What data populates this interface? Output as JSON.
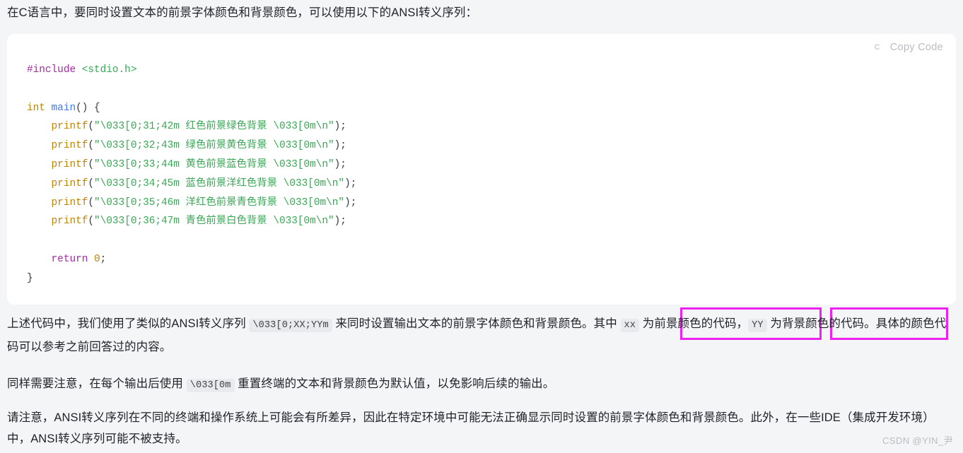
{
  "intro_paragraph": "在C语言中，要同时设置文本的前景字体颜色和背景颜色，可以使用以下的ANSI转义序列：",
  "code_block": {
    "language_label": "c",
    "copy_label": "Copy Code",
    "lines": [
      {
        "id": "l1",
        "tokens": [
          {
            "t": "#include ",
            "c": "t-pre"
          },
          {
            "t": "<stdio.h>",
            "c": "t-str-h"
          }
        ]
      },
      {
        "id": "l2",
        "tokens": []
      },
      {
        "id": "l3",
        "tokens": [
          {
            "t": "int ",
            "c": "t-kw"
          },
          {
            "t": "main",
            "c": "t-fn"
          },
          {
            "t": "() {",
            "c": "t-punct"
          }
        ]
      },
      {
        "id": "l4",
        "tokens": [
          {
            "t": "    ",
            "c": "t-punct"
          },
          {
            "t": "printf",
            "c": "t-call"
          },
          {
            "t": "(",
            "c": "t-punct"
          },
          {
            "t": "\"\\033[0;31;42m 红色前景绿色背景 \\033[0m\\n\"",
            "c": "t-str"
          },
          {
            "t": ");",
            "c": "t-punct"
          }
        ]
      },
      {
        "id": "l5",
        "tokens": [
          {
            "t": "    ",
            "c": "t-punct"
          },
          {
            "t": "printf",
            "c": "t-call"
          },
          {
            "t": "(",
            "c": "t-punct"
          },
          {
            "t": "\"\\033[0;32;43m 绿色前景黄色背景 \\033[0m\\n\"",
            "c": "t-str"
          },
          {
            "t": ");",
            "c": "t-punct"
          }
        ]
      },
      {
        "id": "l6",
        "tokens": [
          {
            "t": "    ",
            "c": "t-punct"
          },
          {
            "t": "printf",
            "c": "t-call"
          },
          {
            "t": "(",
            "c": "t-punct"
          },
          {
            "t": "\"\\033[0;33;44m 黄色前景蓝色背景 \\033[0m\\n\"",
            "c": "t-str"
          },
          {
            "t": ");",
            "c": "t-punct"
          }
        ]
      },
      {
        "id": "l7",
        "tokens": [
          {
            "t": "    ",
            "c": "t-punct"
          },
          {
            "t": "printf",
            "c": "t-call"
          },
          {
            "t": "(",
            "c": "t-punct"
          },
          {
            "t": "\"\\033[0;34;45m 蓝色前景洋红色背景 \\033[0m\\n\"",
            "c": "t-str"
          },
          {
            "t": ");",
            "c": "t-punct"
          }
        ]
      },
      {
        "id": "l8",
        "tokens": [
          {
            "t": "    ",
            "c": "t-punct"
          },
          {
            "t": "printf",
            "c": "t-call"
          },
          {
            "t": "(",
            "c": "t-punct"
          },
          {
            "t": "\"\\033[0;35;46m 洋红色前景青色背景 \\033[0m\\n\"",
            "c": "t-str"
          },
          {
            "t": ");",
            "c": "t-punct"
          }
        ]
      },
      {
        "id": "l9",
        "tokens": [
          {
            "t": "    ",
            "c": "t-punct"
          },
          {
            "t": "printf",
            "c": "t-call"
          },
          {
            "t": "(",
            "c": "t-punct"
          },
          {
            "t": "\"\\033[0;36;47m 青色前景白色背景 \\033[0m\\n\"",
            "c": "t-str"
          },
          {
            "t": ");",
            "c": "t-punct"
          }
        ]
      },
      {
        "id": "l10",
        "tokens": []
      },
      {
        "id": "l11",
        "tokens": [
          {
            "t": "    ",
            "c": "t-punct"
          },
          {
            "t": "return ",
            "c": "t-kw2"
          },
          {
            "t": "0",
            "c": "t-num"
          },
          {
            "t": ";",
            "c": "t-punct"
          }
        ]
      },
      {
        "id": "l12",
        "tokens": [
          {
            "t": "}",
            "c": "t-punct"
          }
        ]
      }
    ]
  },
  "explain_paragraph": {
    "seg1": "上述代码中，我们使用了类似的ANSI转义序列 ",
    "code1": "\\033[0;XX;YYm",
    "seg2": " 来同时设置输出文本的前景字体颜色和背景颜色。其中 ",
    "code2": "xx",
    "seg3": " 为前景颜色的代码，",
    "code3": "YY",
    "seg4": " 为背景颜色的代码。具体的颜色代码可以参考之前回答过的内容。"
  },
  "note_paragraph": {
    "seg1": "同样需要注意，在每个输出后使用 ",
    "code1": "\\033[0m",
    "seg2": " 重置终端的文本和背景颜色为默认值，以免影响后续的输出。"
  },
  "caution_paragraph": "请注意，ANSI转义序列在不同的终端和操作系统上可能会有所差异，因此在特定环境中可能无法正确显示同时设置的前景字体颜色和背景颜色。此外，在一些IDE（集成开发环境）中，ANSI转义序列可能不被支持。",
  "watermark": "CSDN @YIN_尹",
  "colors": {
    "page_background": "#f4f5f7",
    "code_background": "#ffffff",
    "highlight_border": "#ee22ee",
    "chip_background": "#e8eaed",
    "text": "#20232a",
    "muted": "#b7bcc4"
  }
}
